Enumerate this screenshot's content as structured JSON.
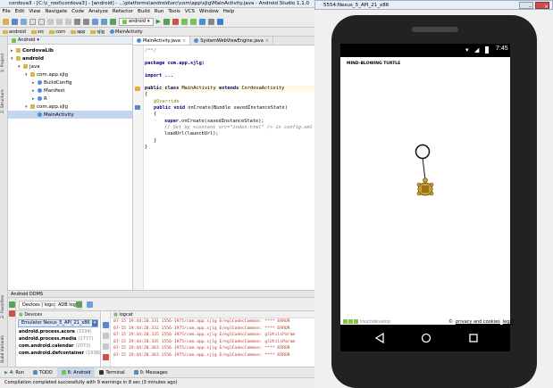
{
  "as": {
    "title": "cordova3 - [C:\\c_root\\cordova3] - [android] - ...\\platforms\\android\\src\\com\\app\\sjlg\\MainActivity.java - Android Studio 1.1.0",
    "menu": [
      "File",
      "Edit",
      "View",
      "Navigate",
      "Code",
      "Analyze",
      "Refactor",
      "Build",
      "Run",
      "Tools",
      "VCS",
      "Window",
      "Help"
    ],
    "run_config": "android",
    "breadcrumbs": [
      "android",
      "src",
      "com",
      "app",
      "sjlg",
      "MainActivity"
    ],
    "left_tabs": [
      "1: Project",
      "2: Structure",
      "Build Variants",
      "2: Favorites"
    ],
    "project_view": "Android",
    "tree": [
      {
        "label": "CordovaLib",
        "indent": 0,
        "arrow": "▸",
        "bold": true
      },
      {
        "label": "android",
        "indent": 0,
        "arrow": "▾",
        "bold": true
      },
      {
        "label": "java",
        "indent": 1,
        "arrow": "▾"
      },
      {
        "label": "com.app.sjlg",
        "indent": 2,
        "arrow": "▾"
      },
      {
        "label": "BuildConfig",
        "indent": 3,
        "arrow": "▸"
      },
      {
        "label": "Manifest",
        "indent": 3,
        "arrow": "▸"
      },
      {
        "label": "R",
        "indent": 3,
        "arrow": "▸"
      },
      {
        "label": "com.app.sjlg",
        "indent": 2,
        "arrow": "▾"
      },
      {
        "label": "MainActivity",
        "indent": 3,
        "arrow": "",
        "selected": true
      }
    ],
    "editor_tabs": [
      "MainActivity.java",
      "SystemWebViewEngine.java"
    ],
    "code": {
      "l1": "/**/",
      "l2": "package com.app.sjlg;",
      "l3": "import ...",
      "l4a": "public class ",
      "l4b": "MainActivity",
      "l4c": " extends ",
      "l4d": "CordovaActivity",
      "l5": "{",
      "l6": "@Override",
      "l7a": "public void ",
      "l7b": "onCreate(Bundle savedInstanceState)",
      "l8": "{",
      "l9a": "super",
      "l9b": ".onCreate(savedInstanceState);",
      "l10": "// Set by <content src=\"index.html\" /> in config.xml",
      "l11": "loadUrl(launchUrl);",
      "l12": "}",
      "l13": "}"
    },
    "dms_title": "Android DDMS",
    "dms_tabs": [
      "Devices | logcat",
      "ADB logs"
    ],
    "devices_label": "Devices",
    "logcat_label": "logcat",
    "emulator": "Emulator Nexus_5_API_21_x86",
    "processes": [
      {
        "name": "android.process.acore",
        "pid": "(1534)"
      },
      {
        "name": "android.process.media",
        "pid": "(1777)"
      },
      {
        "name": "com.android.calendar",
        "pid": "(2073)"
      },
      {
        "name": "com.android.defcontainer",
        "pid": "(1636)"
      }
    ],
    "log_lines": [
      "07-15 19:44:20.331    1556-1975/com.app.sjlg E/eglCodecCommon: **** ERROR",
      "07-15 19:44:20.332    1556-1975/com.app.sjlg E/eglCodecCommon: **** ERROR",
      "07-15 19:44:20.335    1556-1975/com.app.sjlg E/eglCodecCommon: glUtilsParam",
      "07-15 19:44:20.335    1556-1975/com.app.sjlg E/eglCodecCommon: glUtilsParam",
      "07-15 19:44:20.363    1556-1975/com.app.sjlg E/eglCodecCommon: **** ERROR",
      "07-15 19:44:20.363    1556-1975/com.app.sjlg E/eglCodecCommon: **** ERROR"
    ],
    "bottom_tabs": [
      "4: Run",
      "TODO",
      "6: Android",
      "Terminal",
      "0: Messages"
    ],
    "status": "Compilation completed successfully with 9 warnings in 8 sec (3 minutes ago)"
  },
  "emulator": {
    "title": "5554:Nexus_5_API_21_x86",
    "clock": "7:45",
    "app_title": "MIND-BLOWING TURTLE",
    "brand": "touchdevelop",
    "copyright": "©",
    "privacy": "privacy and cookies",
    "legal": "legal"
  }
}
